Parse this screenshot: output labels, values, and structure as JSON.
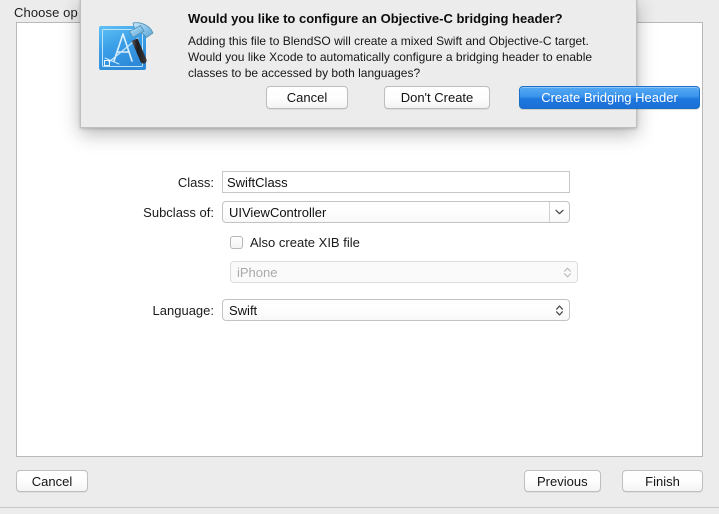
{
  "window": {
    "title": "Choose op"
  },
  "dialog": {
    "icon": "xcode-hammer-blueprint-icon",
    "headline": "Would you like to configure an Objective-C bridging header?",
    "body_line1": "Adding this file to BlendSO will create a mixed Swift and Objective-C target.",
    "body_line2": "Would you like Xcode to automatically configure a bridging header to enable",
    "body_line3": "classes to be accessed by both languages?",
    "buttons": {
      "cancel": "Cancel",
      "dont_create": "Don't Create",
      "create_bridging_header": "Create Bridging Header"
    },
    "accent_color": "#1f79e0"
  },
  "form": {
    "class": {
      "label": "Class:",
      "value": "SwiftClass"
    },
    "subclass": {
      "label": "Subclass of:",
      "value": "UIViewController",
      "chevron": "chevron-down-icon"
    },
    "xib": {
      "label": "Also create XIB file",
      "checked": false
    },
    "device": {
      "value": "iPhone",
      "enabled": false,
      "chevron": "chevron-up-down-icon"
    },
    "language": {
      "label": "Language:",
      "value": "Swift",
      "chevron": "chevron-up-down-icon"
    }
  },
  "footer": {
    "cancel": "Cancel",
    "previous": "Previous",
    "finish": "Finish"
  }
}
